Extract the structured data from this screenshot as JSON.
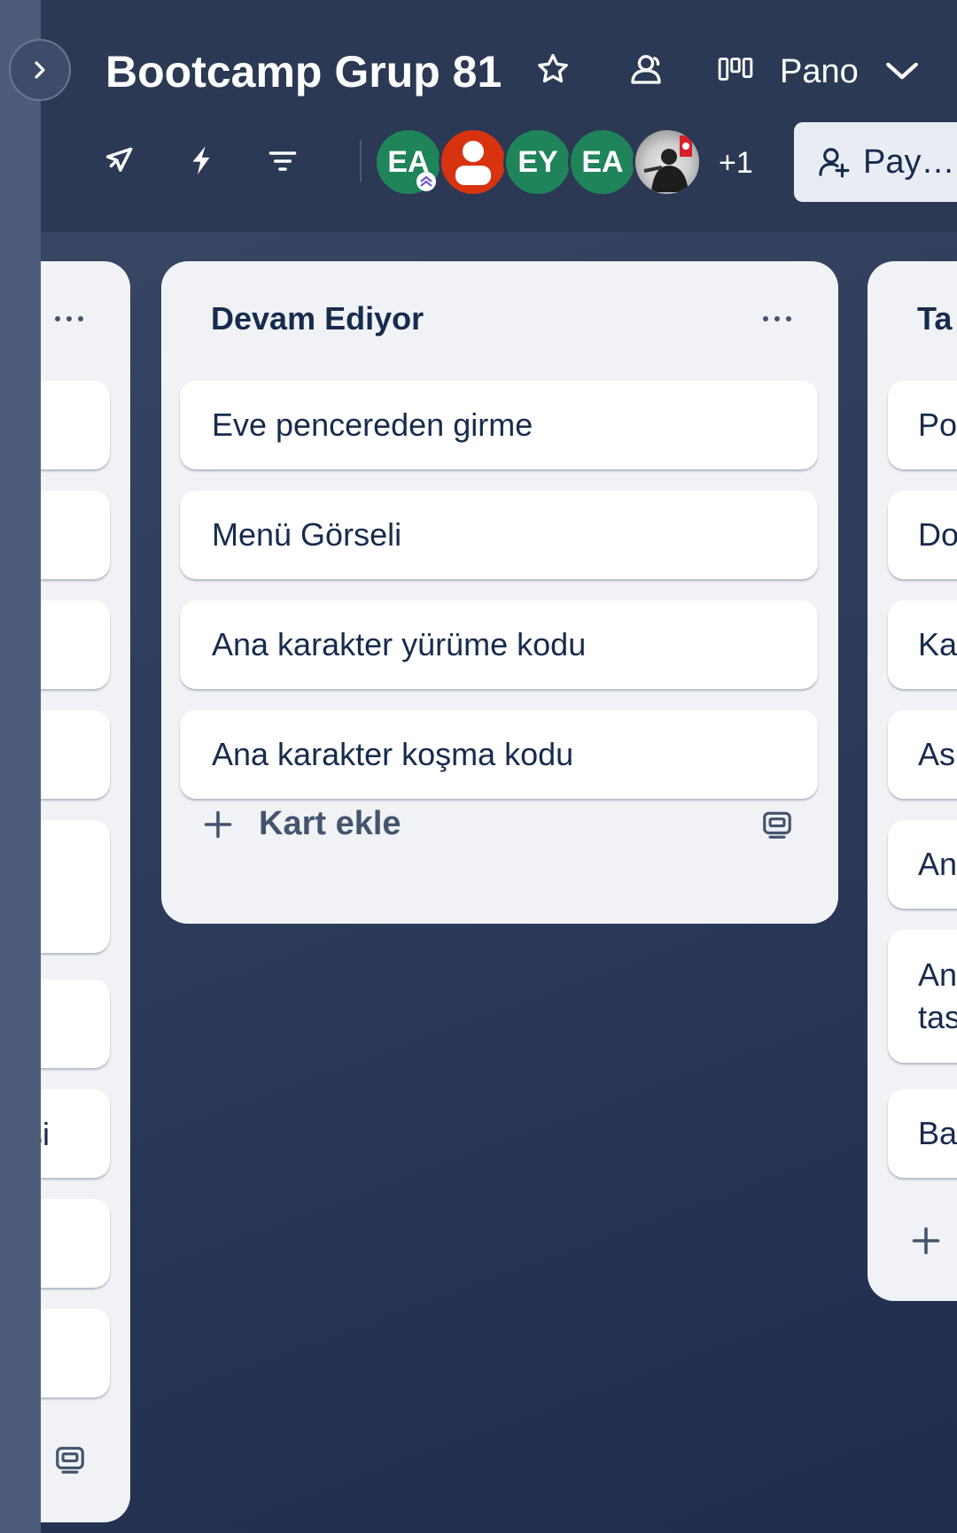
{
  "header": {
    "board_title": "Bootcamp Grup 81",
    "view_label": "Pano",
    "members_more": "+1",
    "share_label": "Pay…",
    "members": [
      {
        "initials": "EA",
        "color": "#1f845a"
      },
      {
        "initials": "",
        "color": "#d8330f"
      },
      {
        "initials": "EY",
        "color": "#1f845a"
      },
      {
        "initials": "EA",
        "color": "#1f845a"
      },
      {
        "initials": "",
        "color": "photo"
      }
    ],
    "icons": [
      "chevron-right-icon",
      "star-icon",
      "visibility-icon",
      "board-view-icon",
      "chevron-down-icon",
      "power-ups-icon",
      "automation-icon",
      "filter-icon",
      "add-member-icon"
    ]
  },
  "lists": {
    "left": {
      "partial_text": "şi"
    },
    "main": {
      "title": "Devam Ediyor",
      "cards": [
        "Eve pencereden girme",
        "Menü Görseli",
        "Ana karakter yürüme kodu",
        "Ana karakter koşma kodu"
      ],
      "add_card_label": "Kart ekle"
    },
    "right": {
      "title": "Ta",
      "cards": [
        "Po",
        "Do",
        "Ka",
        "As",
        "An",
        "An",
        "tas",
        "Ba"
      ]
    }
  },
  "colors": {
    "header_bg": "#2b3954",
    "list_bg": "#f0f2f5",
    "accent_green": "#1f845a",
    "accent_red": "#d8330f"
  }
}
